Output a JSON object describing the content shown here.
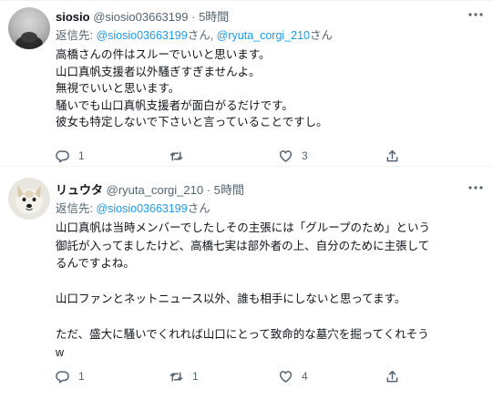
{
  "tweets": [
    {
      "display_name": "siosio",
      "handle": "@siosio03663199",
      "separator": "·",
      "time": "5時間",
      "reply_prefix": "返信先: ",
      "reply_targets": [
        "@siosio03663199",
        "@ryuta_corgi_210"
      ],
      "reply_joiner": "さん, ",
      "reply_suffix": "さん",
      "text_lines": [
        "高橋さんの件はスルーでいいと思います。",
        "山口真帆支援者以外騒ぎすぎませんよ。",
        "無視でいいと思います。",
        "騒いでも山口真帆支援者が面白がるだけです。",
        "彼女も特定しないで下さいと言っていることですし。"
      ],
      "reply_count": "1",
      "retweet_count": "",
      "like_count": "3"
    },
    {
      "display_name": "リュウタ",
      "handle": "@ryuta_corgi_210",
      "separator": "·",
      "time": "5時間",
      "reply_prefix": "返信先: ",
      "reply_targets": [
        "@siosio03663199"
      ],
      "reply_suffix": "さん",
      "text_lines": [
        "山口真帆は当時メンバーでしたしその主張には「グループのため」という",
        "御託が入ってましたけど、高橋七実は部外者の上、自分のために主張して",
        "るんですよね。",
        "",
        "山口ファンとネットニュース以外、誰も相手にしないと思ってます。",
        "",
        "ただ、盛大に騒いでくれれば山口にとって致命的な墓穴を掘ってくれそう",
        "w"
      ],
      "reply_count": "1",
      "retweet_count": "1",
      "like_count": "4"
    }
  ],
  "more_icon": "ellipsis-icon",
  "colors": {
    "link": "#1d9bf0",
    "secondary_text": "#536471",
    "primary_text": "#0f1419",
    "divider": "#eff3f4"
  }
}
